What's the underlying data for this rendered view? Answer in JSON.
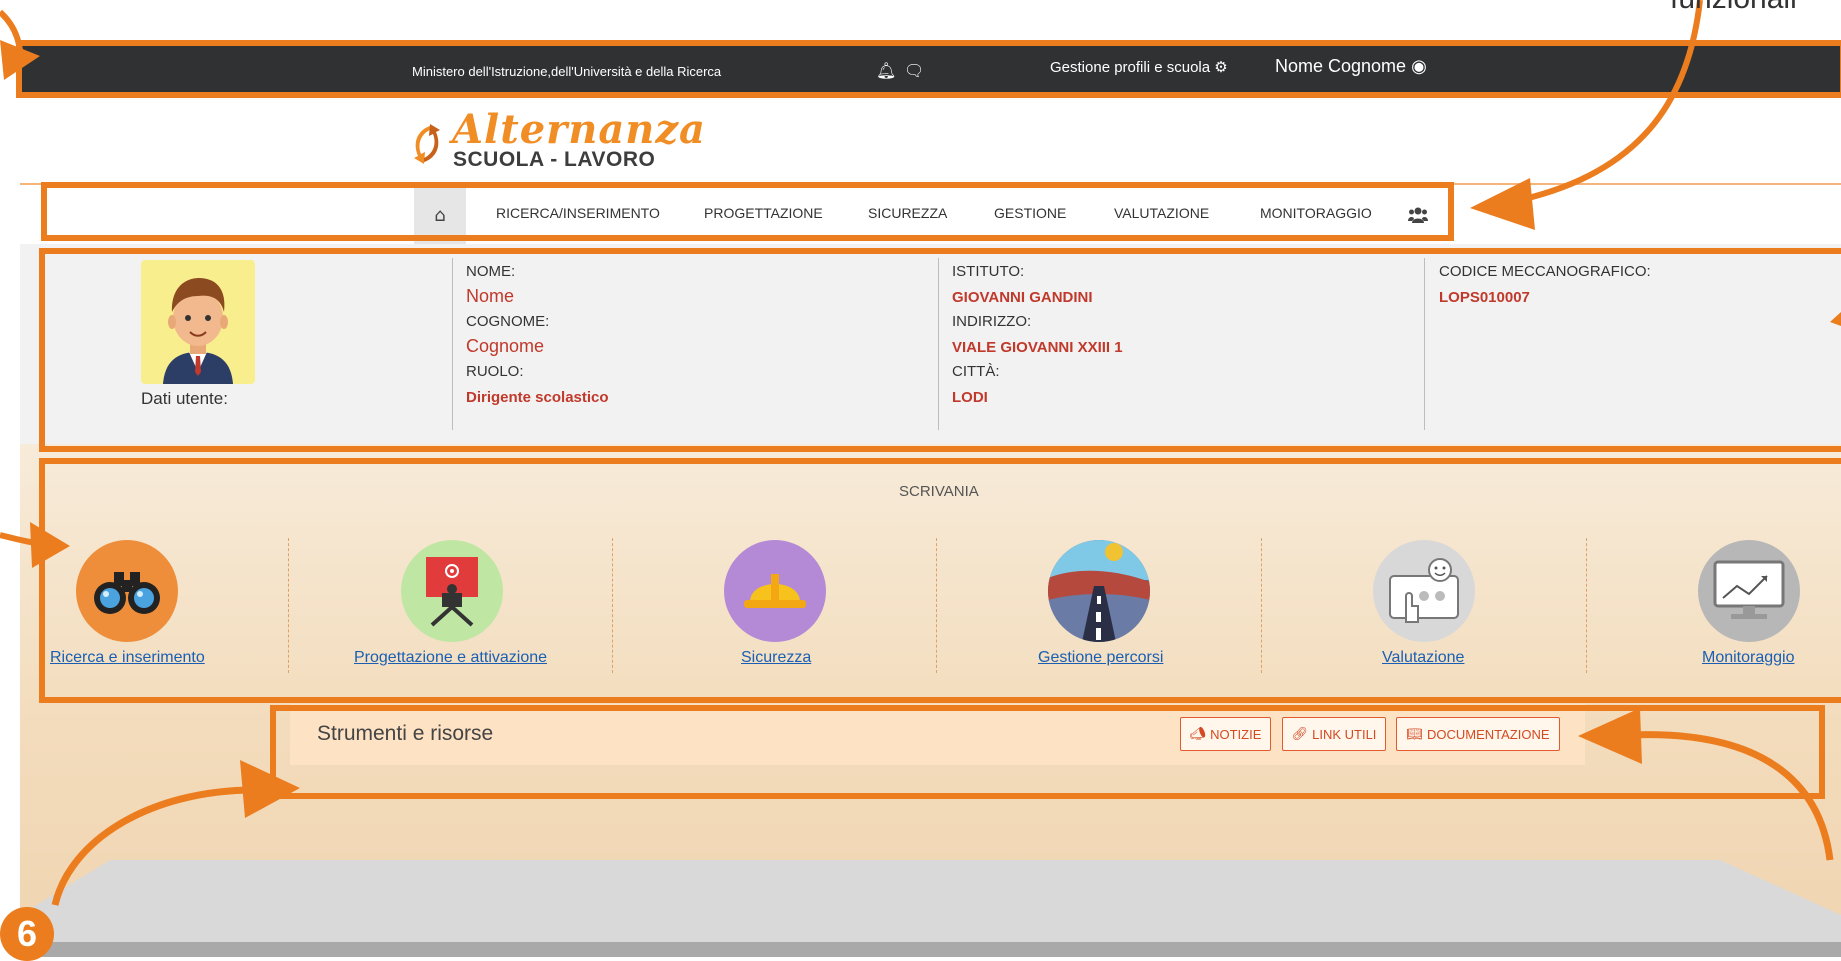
{
  "topbar": {
    "ministry": "Ministero dell'Istruzione,dell'Università e della Ricerca",
    "gestione": "Gestione profili e scuola",
    "username": "Nome Cognome"
  },
  "logo": {
    "top": "Alternanza",
    "bottom": "SCUOLA - LAVORO"
  },
  "nav": {
    "items": [
      "RICERCA/INSERIMENTO",
      "PROGETTAZIONE",
      "SICUREZZA",
      "GESTIONE",
      "VALUTAZIONE",
      "MONITORAGGIO"
    ]
  },
  "user": {
    "caption": "Dati utente:",
    "nome_label": "NOME:",
    "nome_value": "Nome",
    "cognome_label": "COGNOME:",
    "cognome_value": "Cognome",
    "ruolo_label": "RUOLO:",
    "ruolo_value": "Dirigente scolastico",
    "istituto_label": "ISTITUTO:",
    "istituto_value": "GIOVANNI GANDINI",
    "indirizzo_label": "INDIRIZZO:",
    "indirizzo_value": "VIALE GIOVANNI XXIII 1",
    "citta_label": "CITTÀ:",
    "citta_value": "LODI",
    "codice_label": "CODICE MECCANOGRAFICO:",
    "codice_value": "LOPS010007"
  },
  "desk": {
    "title": "SCRIVANIA",
    "items": [
      "Ricerca e inserimento",
      "Progettazione e attivazione",
      "Sicurezza",
      "Gestione percorsi",
      "Valutazione",
      "Monitoraggio"
    ]
  },
  "tools": {
    "title": "Strumenti e risorse",
    "buttons": [
      "NOTIZIE",
      "LINK UTILI",
      "DOCUMENTAZIONE"
    ]
  },
  "annotation": {
    "badge": "6",
    "corner_text": "funzionali"
  },
  "colors": {
    "accent": "#ec7d1f",
    "topbar": "#2f3133",
    "value_red": "#c0392b",
    "link_blue": "#1a5fb4"
  }
}
